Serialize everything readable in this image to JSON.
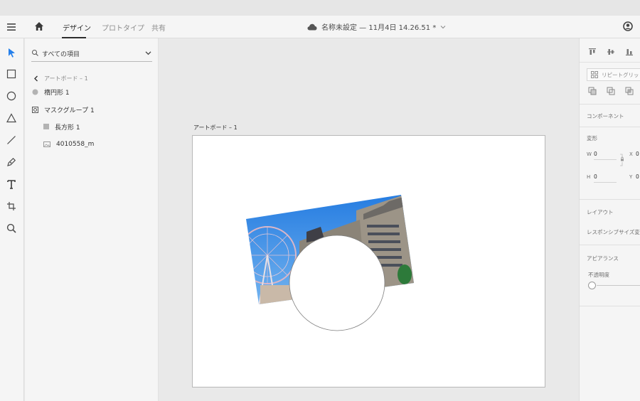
{
  "app": {
    "tabs": [
      {
        "label": "デザイン",
        "active": true
      },
      {
        "label": "プロトタイプ",
        "active": false
      },
      {
        "label": "共有",
        "active": false
      }
    ],
    "document_title": "名称未設定 — 11月4日 14.26.51 *"
  },
  "layers": {
    "filter_label": "すべての項目",
    "breadcrumb": "アートボード – 1",
    "items": [
      {
        "label": "楕円形 1",
        "icon": "ellipse-icon"
      },
      {
        "label": "マスクグループ 1",
        "icon": "mask-group-icon"
      },
      {
        "label": "長方形 1",
        "icon": "rectangle-icon"
      },
      {
        "label": "4010558_m",
        "icon": "image-icon"
      }
    ]
  },
  "canvas": {
    "artboard_label": "アートボード – 1"
  },
  "properties": {
    "repeat_grid_label": "リピートグリッド",
    "component_label": "コンポーネント",
    "transform_label": "変形",
    "w_label": "W",
    "w_value": "0",
    "x_label": "X",
    "x_value": "0",
    "h_label": "H",
    "h_value": "0",
    "y_label": "Y",
    "y_value": "0",
    "layout_label": "レイアウト",
    "responsive_label": "レスポンシブサイズ変更",
    "appearance_label": "アピアランス",
    "opacity_label": "不透明度"
  },
  "colors": {
    "accent": "#2680eb",
    "sky": "#3a8ee6",
    "building": "#8a8276"
  }
}
